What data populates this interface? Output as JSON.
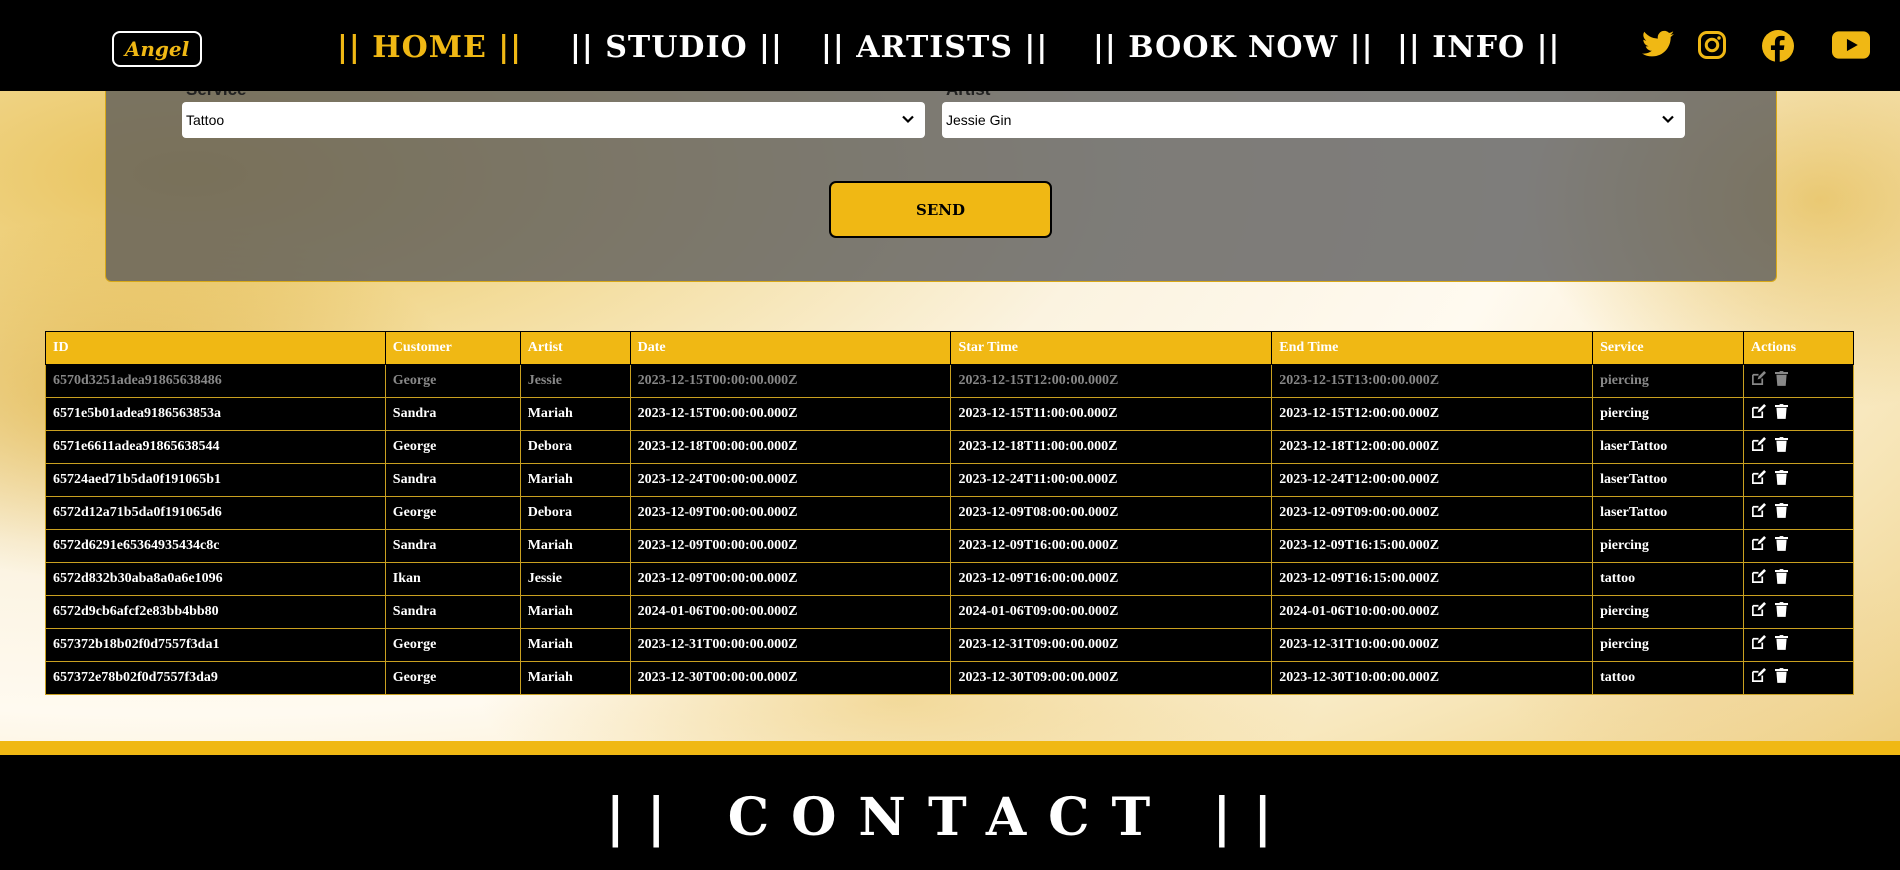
{
  "colors": {
    "accent": "#f0b814",
    "nav_bg": "#000000",
    "panel": "#5a5a5a"
  },
  "nav": {
    "logo": "Angel",
    "items": [
      {
        "label": "|| HOME ||",
        "active": true
      },
      {
        "label": "|| STUDIO ||",
        "active": false
      },
      {
        "label": "|| ARTISTS ||",
        "active": false
      },
      {
        "label": "|| BOOK NOW ||",
        "active": false
      },
      {
        "label": "|| INFO ||",
        "active": false
      }
    ],
    "social": [
      "twitter-icon",
      "instagram-icon",
      "facebook-icon",
      "youtube-icon"
    ]
  },
  "form": {
    "service_label": "Service",
    "service_value": "Tattoo",
    "artist_label": "Artist",
    "artist_value": "Jessie Gin",
    "send_label": "SEND"
  },
  "table": {
    "headers": [
      "ID",
      "Customer",
      "Artist",
      "Date",
      "Star Time",
      "End Time",
      "Service",
      "Actions"
    ],
    "rows": [
      [
        "6570d3251adea91865638486",
        "George",
        "Jessie",
        "2023-12-15T00:00:00.000Z",
        "2023-12-15T12:00:00.000Z",
        "2023-12-15T13:00:00.000Z",
        "piercing"
      ],
      [
        "6571e5b01adea9186563853a",
        "Sandra",
        "Mariah",
        "2023-12-15T00:00:00.000Z",
        "2023-12-15T11:00:00.000Z",
        "2023-12-15T12:00:00.000Z",
        "piercing"
      ],
      [
        "6571e6611adea91865638544",
        "George",
        "Debora",
        "2023-12-18T00:00:00.000Z",
        "2023-12-18T11:00:00.000Z",
        "2023-12-18T12:00:00.000Z",
        "laserTattoo"
      ],
      [
        "65724aed71b5da0f191065b1",
        "Sandra",
        "Mariah",
        "2023-12-24T00:00:00.000Z",
        "2023-12-24T11:00:00.000Z",
        "2023-12-24T12:00:00.000Z",
        "laserTattoo"
      ],
      [
        "6572d12a71b5da0f191065d6",
        "George",
        "Debora",
        "2023-12-09T00:00:00.000Z",
        "2023-12-09T08:00:00.000Z",
        "2023-12-09T09:00:00.000Z",
        "laserTattoo"
      ],
      [
        "6572d6291e65364935434c8c",
        "Sandra",
        "Mariah",
        "2023-12-09T00:00:00.000Z",
        "2023-12-09T16:00:00.000Z",
        "2023-12-09T16:15:00.000Z",
        "piercing"
      ],
      [
        "6572d832b30aba8a0a6e1096",
        "Ikan",
        "Jessie",
        "2023-12-09T00:00:00.000Z",
        "2023-12-09T16:00:00.000Z",
        "2023-12-09T16:15:00.000Z",
        "tattoo"
      ],
      [
        "6572d9cb6afcf2e83bb4bb80",
        "Sandra",
        "Mariah",
        "2024-01-06T00:00:00.000Z",
        "2024-01-06T09:00:00.000Z",
        "2024-01-06T10:00:00.000Z",
        "piercing"
      ],
      [
        "657372b18b02f0d7557f3da1",
        "George",
        "Mariah",
        "2023-12-31T00:00:00.000Z",
        "2023-12-31T09:00:00.000Z",
        "2023-12-31T10:00:00.000Z",
        "piercing"
      ],
      [
        "657372e78b02f0d7557f3da9",
        "George",
        "Mariah",
        "2023-12-30T00:00:00.000Z",
        "2023-12-30T09:00:00.000Z",
        "2023-12-30T10:00:00.000Z",
        "tattoo"
      ]
    ]
  },
  "footer": {
    "title": "|| CONTACT ||"
  }
}
